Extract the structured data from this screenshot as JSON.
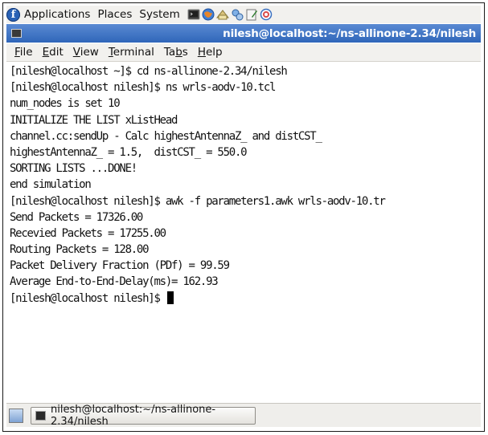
{
  "panel": {
    "menus": [
      "Applications",
      "Places",
      "System"
    ],
    "launchers": [
      "terminal-icon",
      "browser-icon",
      "mail-icon",
      "network-icon",
      "text-editor-icon",
      "help-icon"
    ]
  },
  "window": {
    "title": "nilesh@localhost:~/ns-allinone-2.34/nilesh"
  },
  "menubar": {
    "items": [
      {
        "pre": "",
        "mn": "F",
        "post": "ile"
      },
      {
        "pre": "",
        "mn": "E",
        "post": "dit"
      },
      {
        "pre": "",
        "mn": "V",
        "post": "iew"
      },
      {
        "pre": "",
        "mn": "T",
        "post": "erminal"
      },
      {
        "pre": "Ta",
        "mn": "b",
        "post": "s"
      },
      {
        "pre": "",
        "mn": "H",
        "post": "elp"
      }
    ]
  },
  "terminal": {
    "lines": [
      "[nilesh@localhost ~]$ cd ns-allinone-2.34/nilesh",
      "[nilesh@localhost nilesh]$ ns wrls-aodv-10.tcl",
      "num_nodes is set 10",
      "INITIALIZE THE LIST xListHead",
      "channel.cc:sendUp - Calc highestAntennaZ_ and distCST_",
      "highestAntennaZ_ = 1.5,  distCST_ = 550.0",
      "SORTING LISTS ...DONE!",
      "end simulation",
      "[nilesh@localhost nilesh]$ awk -f parameters1.awk wrls-aodv-10.tr",
      "Send Packets = 17326.00",
      "Recevied Packets = 17255.00",
      "Routing Packets = 128.00",
      "Packet Delivery Fraction (PDf) = 99.59",
      "Average End-to-End-Delay(ms)= 162.93"
    ],
    "prompt": "[nilesh@localhost nilesh]$ "
  },
  "taskbar": {
    "task_label": "nilesh@localhost:~/ns-allinone-2.34/nilesh"
  }
}
